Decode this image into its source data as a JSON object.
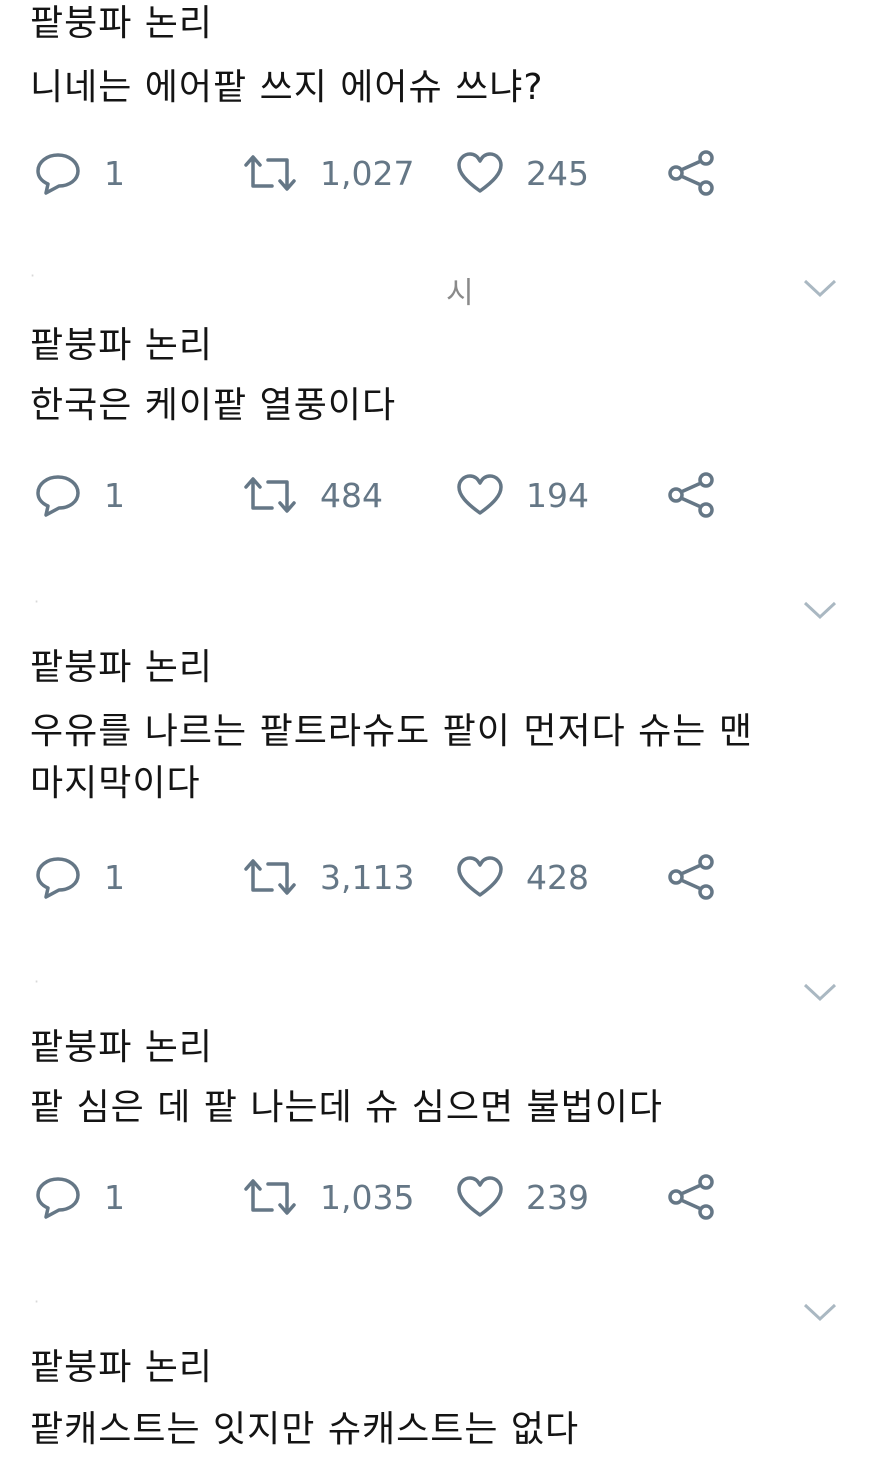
{
  "tweets": [
    {
      "lines": [
        "팥붕파 논리",
        "니네는 에어팥 쓰지 에어슈 쓰냐?"
      ],
      "reply_count": "1",
      "retweet_count": "1,027",
      "like_count": "245"
    },
    {
      "lines": [
        "팥붕파 논리",
        "한국은 케이팥 열풍이다"
      ],
      "reply_count": "1",
      "retweet_count": "484",
      "like_count": "194"
    },
    {
      "lines": [
        "팥붕파 논리",
        "우유를 나르는 팥트라슈도 팥이 먼저다 슈는 맨",
        "마지막이다"
      ],
      "reply_count": "1",
      "retweet_count": "3,113",
      "like_count": "428"
    },
    {
      "lines": [
        "팥붕파 논리",
        "팥 심은 데 팥 나는데 슈 심으면 불법이다"
      ],
      "reply_count": "1",
      "retweet_count": "1,035",
      "like_count": "239"
    },
    {
      "lines": [
        "팥붕파 논리",
        "팥캐스트는 잇지만 슈캐스트는 없다"
      ]
    }
  ],
  "header_fragment": "시",
  "icons": {
    "reply": "reply-icon",
    "retweet": "retweet-icon",
    "like": "heart-icon",
    "share": "share-icon",
    "more": "chevron-down-icon"
  },
  "colors": {
    "text": "#141414",
    "icon": "#657786",
    "chevron": "#aab8c2"
  }
}
